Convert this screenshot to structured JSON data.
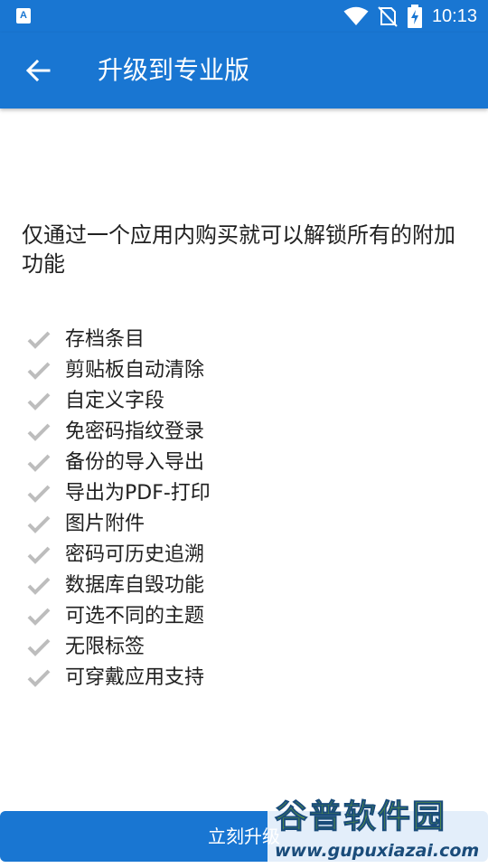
{
  "status_bar": {
    "app_icon_letter": "A",
    "time": "10:13",
    "icons": [
      "wifi-icon",
      "no-sim-icon",
      "battery-charging-icon"
    ]
  },
  "app_bar": {
    "back_icon": "arrow-left-icon",
    "title": "升级到专业版"
  },
  "intro": {
    "text": "仅通过一个应用内购买就可以解锁所有的附加功能"
  },
  "features": [
    "存档条目",
    "剪贴板自动清除",
    "自定义字段",
    "免密码指纹登录",
    "备份的导入导出",
    "导出为PDF-打印",
    "图片附件",
    "密码可历史追溯",
    "数据库自毁功能",
    "可选不同的主题",
    "无限标签",
    "可穿戴应用支持"
  ],
  "upgrade_button": {
    "label": "立刻升级"
  },
  "watermark": {
    "title": "谷普软件园",
    "url": "www.gupuxiazai.com"
  },
  "colors": {
    "primary": "#1976d2",
    "check": "#bdbdbd",
    "text": "#212121"
  }
}
